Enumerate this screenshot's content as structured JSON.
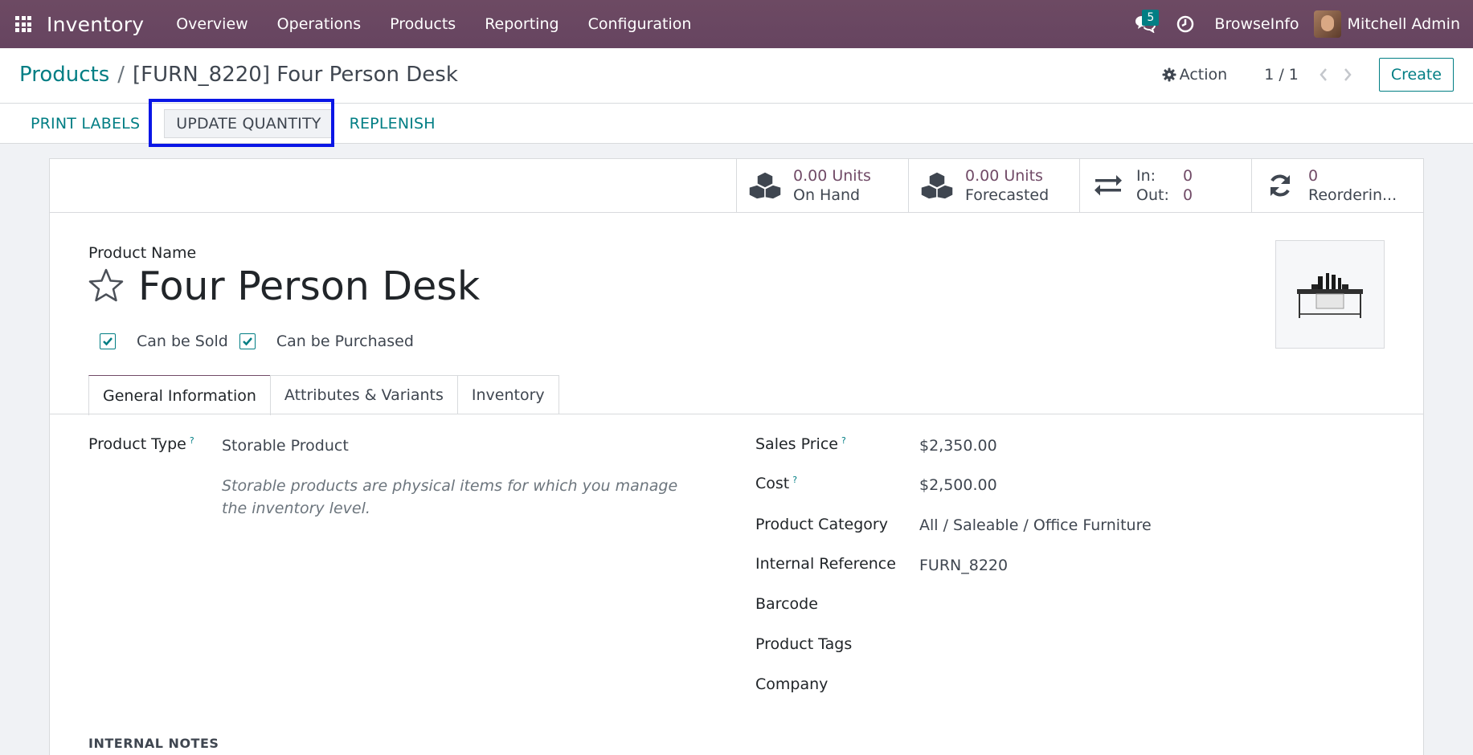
{
  "navbar": {
    "app_name": "Inventory",
    "menu": [
      "Overview",
      "Operations",
      "Products",
      "Reporting",
      "Configuration"
    ],
    "chat_count": "5",
    "company": "BrowseInfo",
    "user_name": "Mitchell Admin"
  },
  "control": {
    "breadcrumb_parent": "Products",
    "breadcrumb_sep": "/",
    "breadcrumb_current": "[FURN_8220] Four Person Desk",
    "action_label": "Action",
    "pager_value": "1 / 1",
    "create_label": "Create",
    "status_buttons": {
      "print_labels": "PRINT LABELS",
      "update_quantity": "UPDATE QUANTITY",
      "replenish": "REPLENISH"
    }
  },
  "stats": {
    "on_hand_value": "0.00 Units",
    "on_hand_label": "On Hand",
    "forecasted_value": "0.00 Units",
    "forecasted_label": "Forecasted",
    "in_label": "In:",
    "in_value": "0",
    "out_label": "Out:",
    "out_value": "0",
    "reordering_value": "0",
    "reordering_label": "Reorderin..."
  },
  "product": {
    "name_label": "Product Name",
    "name": "Four Person Desk",
    "can_be_sold": "Can be Sold",
    "can_be_purchased": "Can be Purchased"
  },
  "tabs": [
    "General Information",
    "Attributes & Variants",
    "Inventory"
  ],
  "general": {
    "product_type_label": "Product Type",
    "product_type_value": "Storable Product",
    "product_type_hint": "Storable products are physical items for which you manage the inventory level.",
    "sales_price_label": "Sales Price",
    "sales_price_value": "$2,350.00",
    "cost_label": "Cost",
    "cost_value": "$2,500.00",
    "category_label": "Product Category",
    "category_value": "All / Saleable / Office Furniture",
    "internal_ref_label": "Internal Reference",
    "internal_ref_value": "FURN_8220",
    "barcode_label": "Barcode",
    "tags_label": "Product Tags",
    "company_label": "Company",
    "help_mark": "?"
  },
  "notes_title": "INTERNAL NOTES"
}
